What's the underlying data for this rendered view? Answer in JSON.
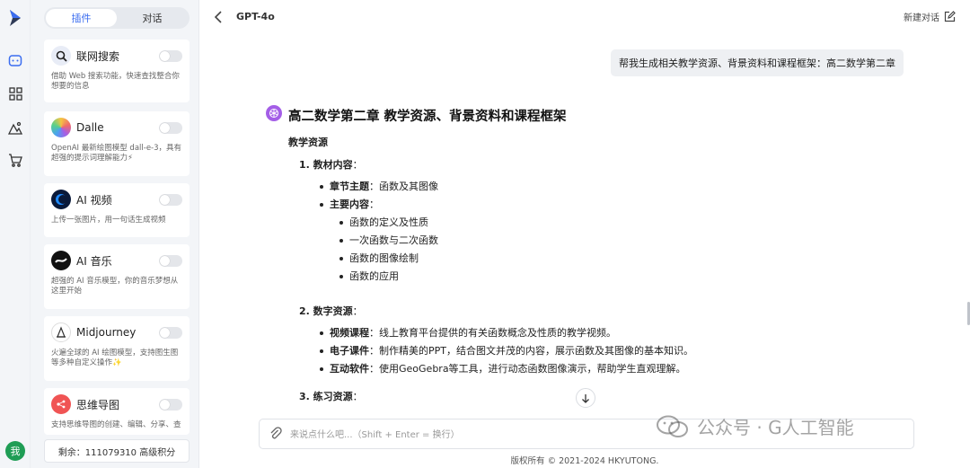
{
  "sidebar": {
    "tabs": [
      {
        "label": "插件",
        "active": true
      },
      {
        "label": "对话",
        "active": false
      }
    ],
    "plugins": [
      {
        "name": "联网搜索",
        "desc": "借助 Web 搜索功能，快速查找整合你想要的信息",
        "icon": "search-icon"
      },
      {
        "name": "Dalle",
        "desc": "OpenAI 最新绘图模型 dall-e-3，具有超强的提示词理解能力⚡",
        "icon": "dalle-icon"
      },
      {
        "name": "AI 视频",
        "desc": "上传一张图片，用一句话生成视频",
        "icon": "ai-video-icon"
      },
      {
        "name": "AI 音乐",
        "desc": "超强的 AI 音乐模型，你的音乐梦想从这里开始",
        "icon": "ai-music-icon"
      },
      {
        "name": "Midjourney",
        "desc": "火遍全球的 AI 绘图模型，支持图生图等多种自定义操作✨",
        "icon": "midjourney-icon"
      },
      {
        "name": "思维导图",
        "desc": "支持思维导图的创建、编辑、分享、查",
        "icon": "mindmap-icon"
      }
    ],
    "credits": "剩余：111079310 高级积分",
    "user_avatar": "我"
  },
  "header": {
    "model": "GPT-4o",
    "new_chat": "新建对话"
  },
  "conversation": {
    "user_message": "帮我生成相关教学资源、背景资料和课程框架：高二数学第二章",
    "answer": {
      "title": "高二数学第二章 教学资源、背景资料和课程框架",
      "section": "教学资源",
      "item1": {
        "label": "1. 教材内容",
        "suffix": "：",
        "topic_key": "章节主题",
        "topic_value": "：函数及其图像",
        "main_key": "主要内容",
        "main_suffix": "：",
        "sub_items": [
          "函数的定义及性质",
          "一次函数与二次函数",
          "函数的图像绘制",
          "函数的应用"
        ]
      },
      "item2": {
        "label": "2. 数字资源",
        "suffix": "：",
        "entries": [
          {
            "key": "视频课程",
            "value": "：线上教育平台提供的有关函数概念及性质的教学视频。"
          },
          {
            "key": "电子课件",
            "value": "：制作精美的PPT，结合图文并茂的内容，展示函数及其图像的基本知识。"
          },
          {
            "key": "互动软件",
            "value": "：使用GeoGebra等工具，进行动态函数图像演示，帮助学生直观理解。"
          }
        ]
      },
      "item3": {
        "label": "3. 练习资源",
        "suffix": "："
      }
    }
  },
  "composer": {
    "placeholder": "来说点什么吧...（Shift + Enter = 换行）"
  },
  "footer": "版权所有 © 2021-2024 HKYUTONG.",
  "watermark": "公众号 · G人工智能",
  "colors": {
    "accent": "#3b6df0",
    "gpt_icon": "#a45ee7",
    "avatar": "#1f9d55"
  }
}
